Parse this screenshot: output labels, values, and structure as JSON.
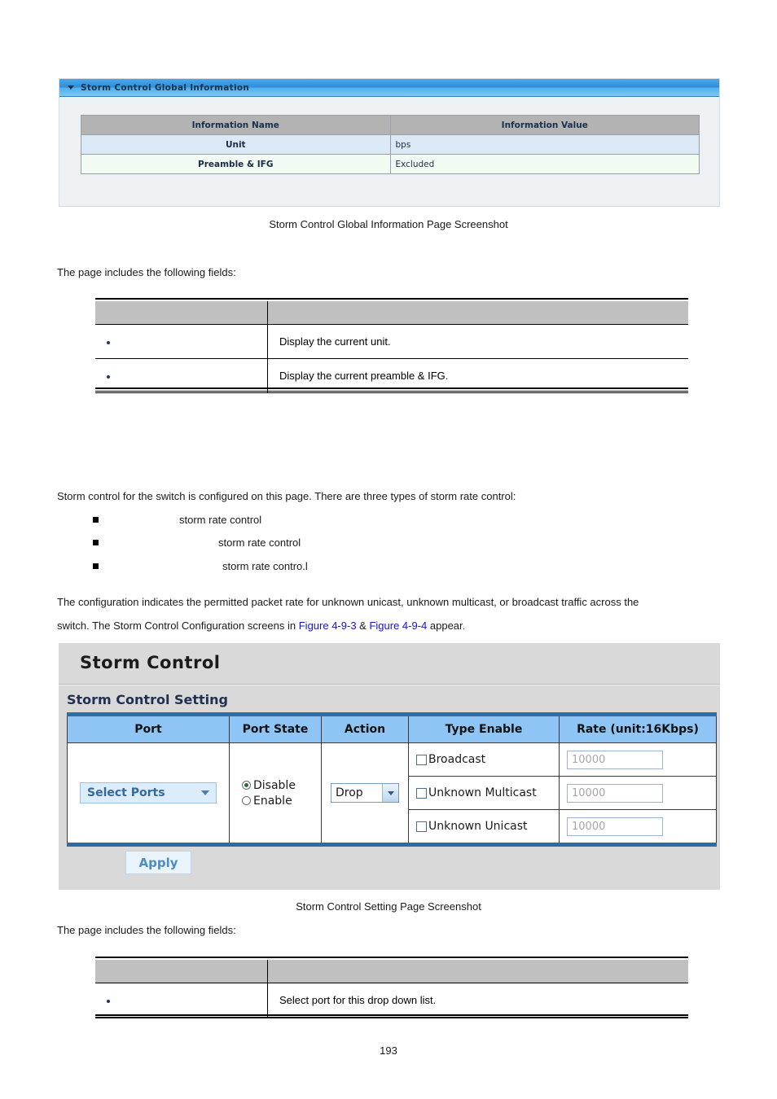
{
  "document": {
    "page_number": "193",
    "intro_text_1": "The page includes the following fields:",
    "intro_text_2": "The page includes the following fields:",
    "caption_1": "Storm Control Global Information Page Screenshot",
    "caption_2": "Storm Control Setting Page Screenshot",
    "paragraph_1": "Storm control for the switch is configured on this page. There are three types of storm rate control:",
    "bullets": [
      "storm rate control",
      "storm rate control",
      "storm rate contro.l"
    ],
    "paragraph_2_a": "The configuration indicates the permitted packet rate for unknown unicast, unknown multicast, or broadcast traffic across the",
    "paragraph_2_b_pre": "switch. The Storm Control Configuration screens in ",
    "paragraph_2_link_1": "Figure 4-9-3",
    "paragraph_2_amp": " & ",
    "paragraph_2_link_2": "Figure 4-9-4",
    "paragraph_2_b_post": " appear.",
    "link_color": "#1414d2"
  },
  "global_info_panel": {
    "header_title": "Storm Control Global Information",
    "header_icon": "collapse-triangle-icon",
    "table": {
      "headers": [
        "Information Name",
        "Information Value"
      ],
      "rows": [
        {
          "name": "Unit",
          "value": "bps"
        },
        {
          "name": "Preamble & IFG",
          "value": "Excluded"
        }
      ]
    },
    "colors": {
      "header_gradient_top": "#4ea6e8",
      "header_gradient_bottom": "#79c7f5",
      "table_header_bg": "#b3b3b3",
      "row1_bg": "#dbe9f7",
      "row2_bg": "#f2faf4"
    }
  },
  "field_table_1": {
    "headers": [
      "",
      ""
    ],
    "rows": [
      {
        "object": "",
        "description": "Display the current unit."
      },
      {
        "object": "",
        "description": "Display the current preamble & IFG."
      }
    ]
  },
  "field_table_2": {
    "headers": [
      "",
      ""
    ],
    "rows": [
      {
        "object": "",
        "description": "Select port for this drop down list."
      }
    ]
  },
  "storm_control_panel": {
    "title": "Storm Control",
    "subtitle": "Storm Control Setting",
    "table_headers": [
      "Port",
      "Port State",
      "Action",
      "Type Enable",
      "Rate (unit:16Kbps)"
    ],
    "port_select": {
      "label": "Select Ports",
      "icon": "chevron-down-icon"
    },
    "port_state": {
      "options": [
        "Disable",
        "Enable"
      ],
      "selected": "Disable"
    },
    "action": {
      "selected": "Drop",
      "icon": "chevron-down-icon"
    },
    "types": [
      {
        "label": "Broadcast",
        "checked": false,
        "rate": "10000"
      },
      {
        "label": "Unknown Multicast",
        "checked": false,
        "rate": "10000"
      },
      {
        "label": "Unknown Unicast",
        "checked": false,
        "rate": "10000"
      }
    ],
    "apply_label": "Apply",
    "colors": {
      "panel_bg": "#d9d9d9",
      "table_header_bg": "#8ec5f5",
      "table_frame": "#2e6ca4",
      "apply_text": "#4a8cc4"
    }
  }
}
